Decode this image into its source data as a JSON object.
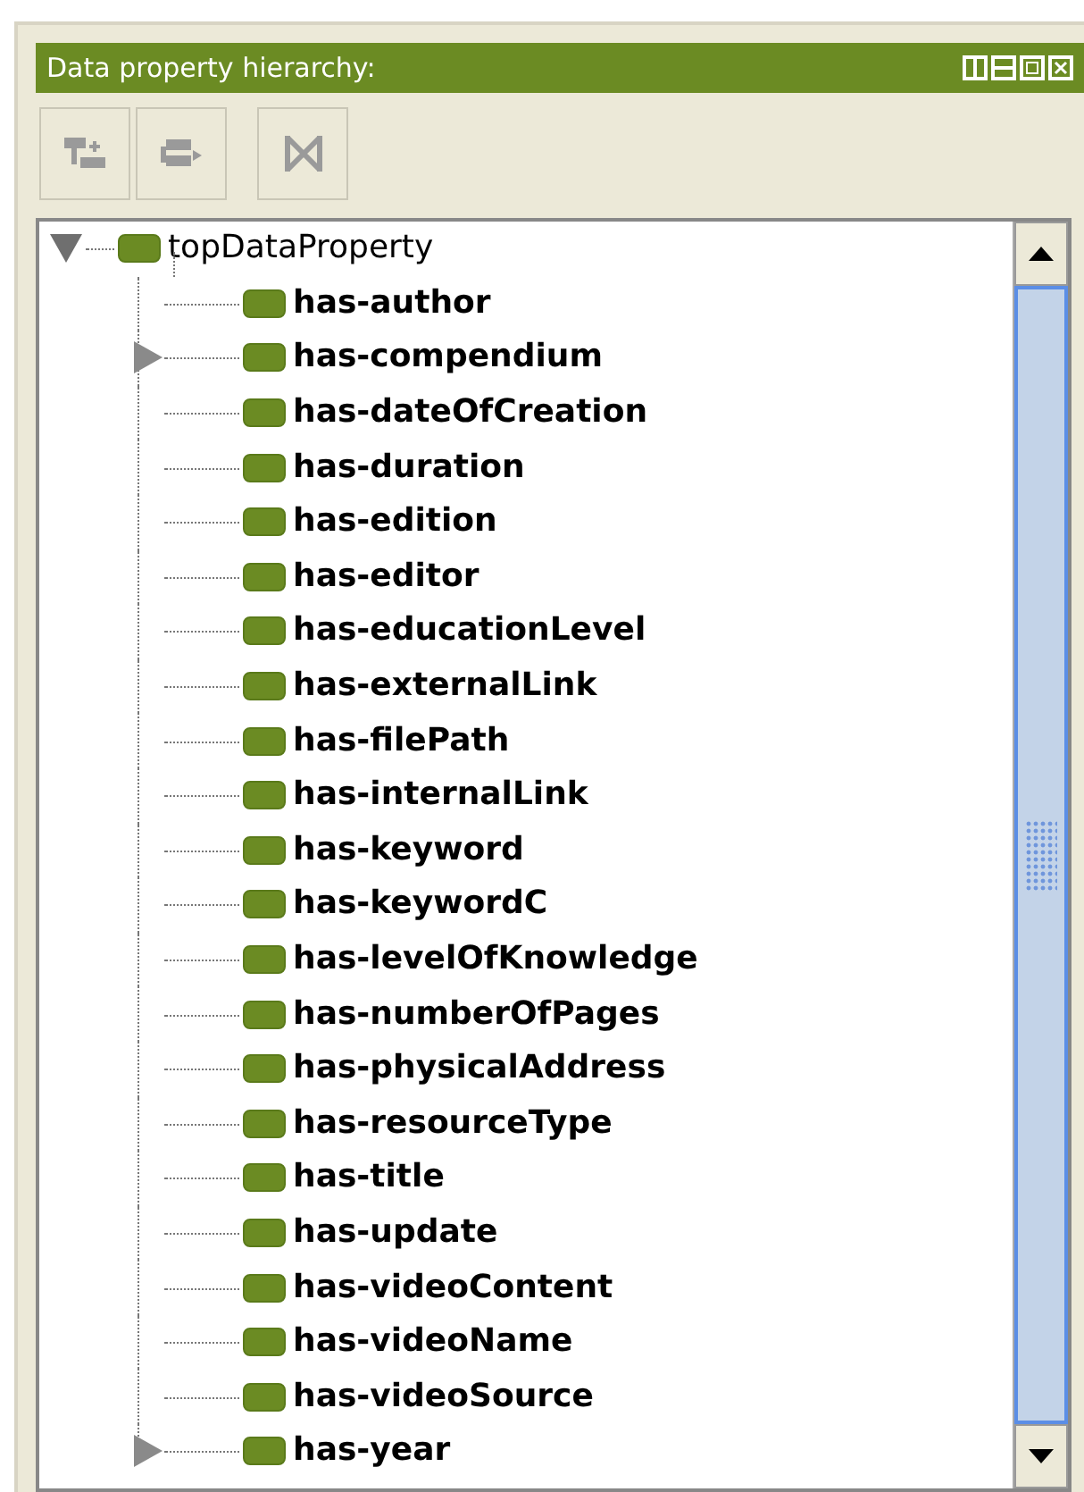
{
  "panel": {
    "title": "Data property hierarchy:"
  },
  "toolbar": [
    {
      "kind": "add-sub",
      "disabled": true
    },
    {
      "kind": "add-sibling",
      "disabled": true
    },
    {
      "kind": "delete",
      "disabled": true
    }
  ],
  "tree": {
    "label": "topDataProperty",
    "bold": false,
    "expanded": true,
    "children": [
      {
        "label": "has-author",
        "bold": true
      },
      {
        "label": "has-compendium",
        "bold": true,
        "expanded": false
      },
      {
        "label": "has-dateOfCreation",
        "bold": true
      },
      {
        "label": "has-duration",
        "bold": true
      },
      {
        "label": "has-edition",
        "bold": true
      },
      {
        "label": "has-editor",
        "bold": true
      },
      {
        "label": "has-educationLevel",
        "bold": true
      },
      {
        "label": "has-externalLink",
        "bold": true
      },
      {
        "label": "has-filePath",
        "bold": true
      },
      {
        "label": "has-internalLink",
        "bold": true
      },
      {
        "label": "has-keyword",
        "bold": true
      },
      {
        "label": "has-keywordC",
        "bold": true
      },
      {
        "label": "has-levelOfKnowledge",
        "bold": true
      },
      {
        "label": "has-numberOfPages",
        "bold": true
      },
      {
        "label": "has-physicalAddress",
        "bold": true
      },
      {
        "label": "has-resourceType",
        "bold": true
      },
      {
        "label": "has-title",
        "bold": true
      },
      {
        "label": "has-update",
        "bold": true
      },
      {
        "label": "has-videoContent",
        "bold": true
      },
      {
        "label": "has-videoName",
        "bold": true
      },
      {
        "label": "has-videoSource",
        "bold": true
      },
      {
        "label": "has-year",
        "bold": true,
        "expanded": false
      }
    ]
  }
}
